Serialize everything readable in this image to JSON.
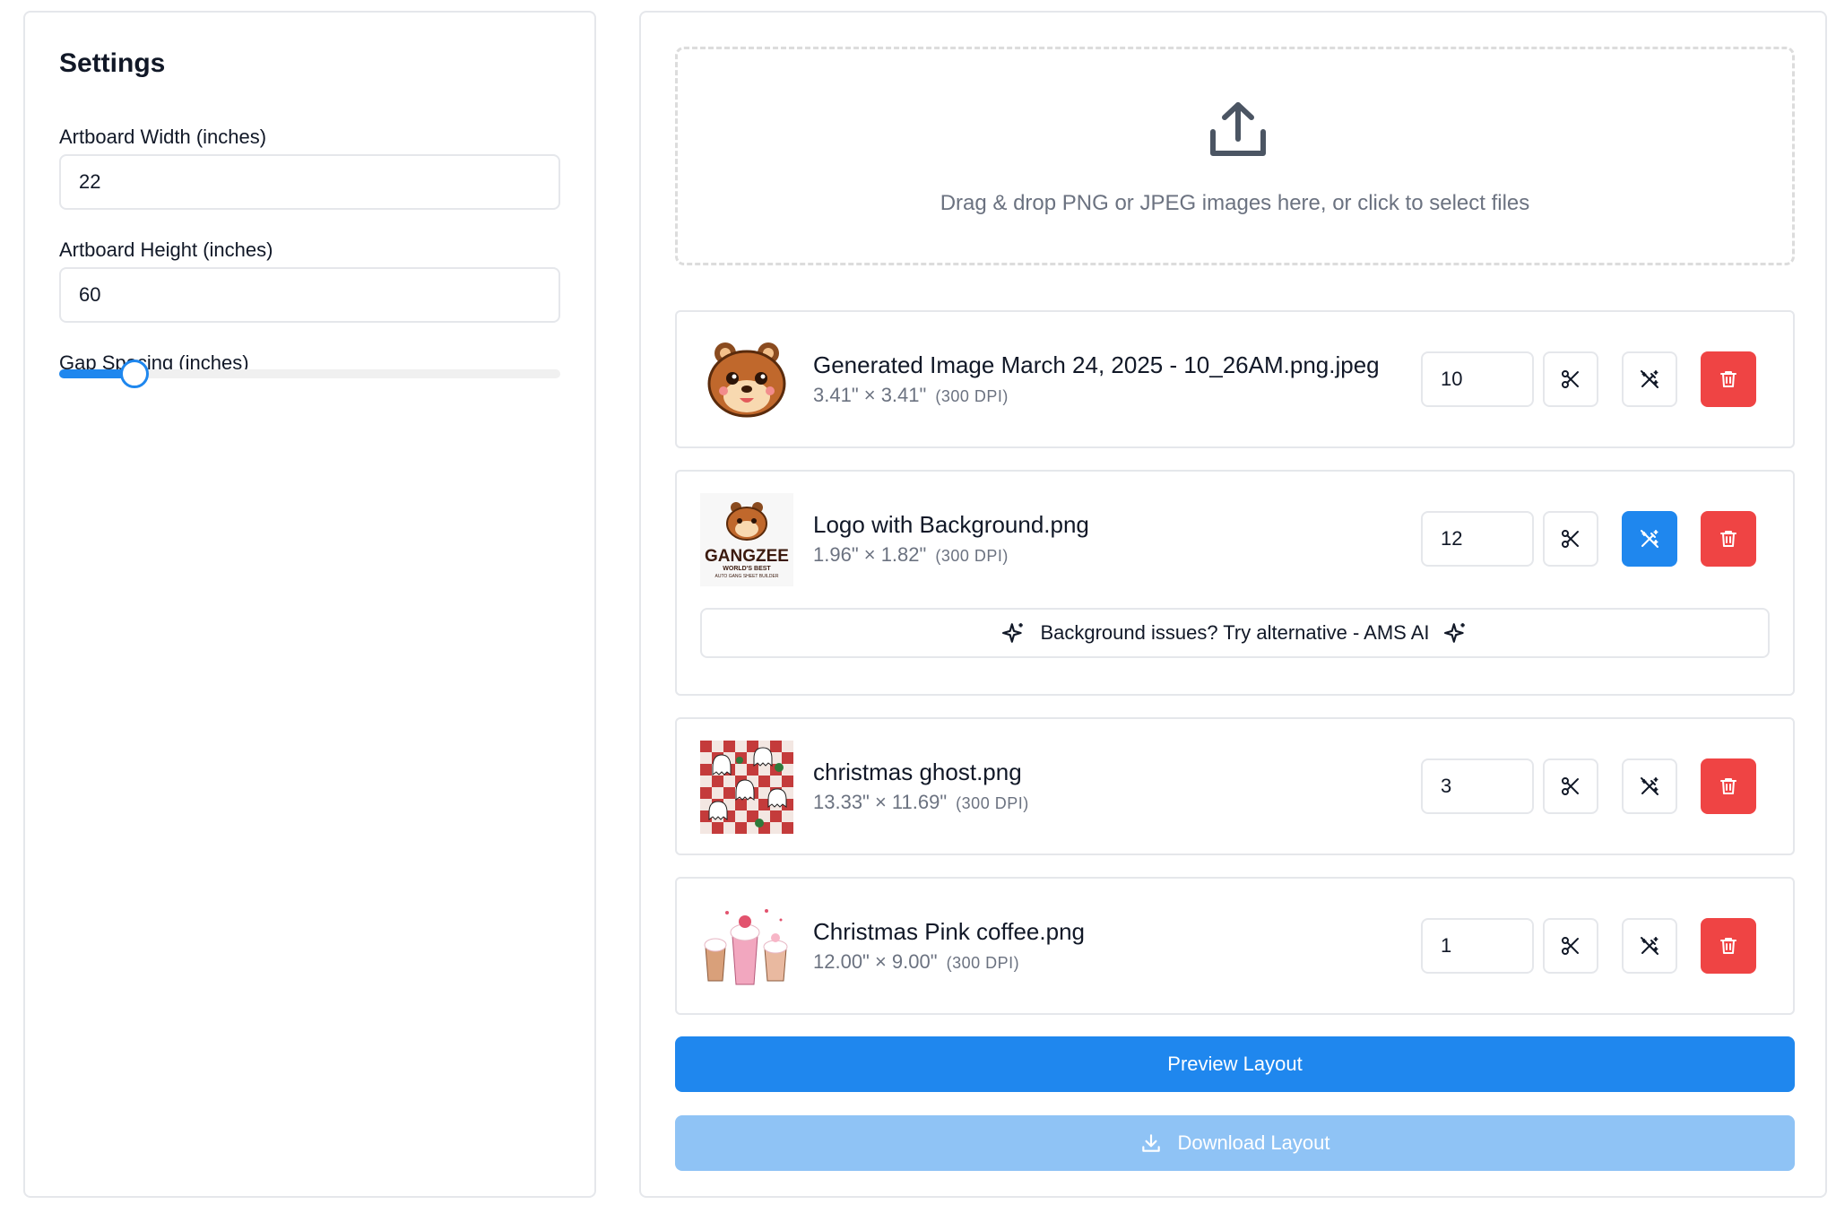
{
  "settings": {
    "title": "Settings",
    "width_label": "Artboard Width (inches)",
    "width_value": "22",
    "height_label": "Artboard Height (inches)",
    "height_value": "60",
    "gap_label": "Gap Spacing (inches)",
    "gap_level_fraction": 0.15
  },
  "upload": {
    "text": "Drag & drop PNG or JPEG images here, or click to select files",
    "icon": "upload-icon"
  },
  "files": [
    {
      "name": "Generated Image March 24, 2025 - 10_26AM.png.jpeg",
      "dims": "3.41\" × 3.41\"",
      "dpi": "(300 DPI)",
      "quantity": "10",
      "bg_removal_active": false
    },
    {
      "name": "Logo with Background.png",
      "dims": "1.96\" × 1.82\"",
      "dpi": "(300 DPI)",
      "quantity": "12",
      "bg_removal_active": true,
      "alt_text": "Background issues? Try alternative - AMS AI",
      "logo_text": "GANGZEE",
      "logo_tagline": "WORLD'S BEST",
      "logo_subtag": "AUTO GANG SHEET BUILDER"
    },
    {
      "name": "christmas ghost.png",
      "dims": "13.33\" × 11.69\"",
      "dpi": "(300 DPI)",
      "quantity": "3",
      "bg_removal_active": false
    },
    {
      "name": "Christmas Pink coffee.png",
      "dims": "12.00\" × 9.00\"",
      "dpi": "(300 DPI)",
      "quantity": "1",
      "bg_removal_active": false
    }
  ],
  "actions": {
    "preview_label": "Preview Layout",
    "download_label": "Download Layout"
  },
  "colors": {
    "accent": "#1f87ee",
    "danger": "#ef4444",
    "disabled": "#8fc3f5"
  }
}
